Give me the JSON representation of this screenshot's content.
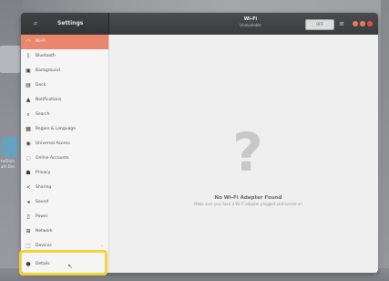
{
  "window": {
    "sidebar_title": "Settings",
    "main_title": "Wi-Fi",
    "main_subtitle": "Unavailable",
    "toggle_label": "OFF",
    "menu_glyph": "≡",
    "search_glyph": "⌕",
    "controls": {
      "minimize_color": "#e87b5f",
      "maximize_color": "#e87b5f",
      "close_color": "#e0513b"
    }
  },
  "sidebar": {
    "items": [
      {
        "label": "Wi-Fi",
        "icon": "wifi-icon",
        "glyph": "◠",
        "selected": true
      },
      {
        "label": "Bluetooth",
        "icon": "bluetooth-icon",
        "glyph": "ᛒ"
      },
      {
        "label": "Background",
        "icon": "background-icon",
        "glyph": "▣"
      },
      {
        "label": "Dock",
        "icon": "dock-icon",
        "glyph": "▤"
      },
      {
        "label": "Notifications",
        "icon": "bell-icon",
        "glyph": "▲"
      },
      {
        "label": "Search",
        "icon": "search-icon",
        "glyph": "⌕"
      },
      {
        "label": "Region & Language",
        "icon": "region-icon",
        "glyph": "▦"
      },
      {
        "label": "Universal Access",
        "icon": "accessibility-icon",
        "glyph": "◉"
      },
      {
        "label": "Online Accounts",
        "icon": "accounts-icon",
        "glyph": "◌"
      },
      {
        "label": "Privacy",
        "icon": "privacy-icon",
        "glyph": "☗"
      },
      {
        "label": "Sharing",
        "icon": "sharing-icon",
        "glyph": "≺"
      },
      {
        "label": "Sound",
        "icon": "sound-icon",
        "glyph": "◂"
      },
      {
        "label": "Power",
        "icon": "power-icon",
        "glyph": "▯"
      },
      {
        "label": "Network",
        "icon": "network-icon",
        "glyph": "⊞"
      },
      {
        "label": "Devices",
        "icon": "devices-icon",
        "glyph": "⬚",
        "chevron": "›"
      },
      {
        "label": "Details",
        "icon": "details-icon",
        "glyph": "●"
      }
    ]
  },
  "main": {
    "message_title": "No Wi-Fi Adapter Found",
    "message_subtitle": "Make sure you have a Wi-Fi adapter plugged and turned on",
    "placeholder_glyph": "?"
  },
  "desktop": {
    "label_line1": "ta/Dum",
    "label_line2": "ark Des"
  },
  "highlight_color": "#f2d23a"
}
